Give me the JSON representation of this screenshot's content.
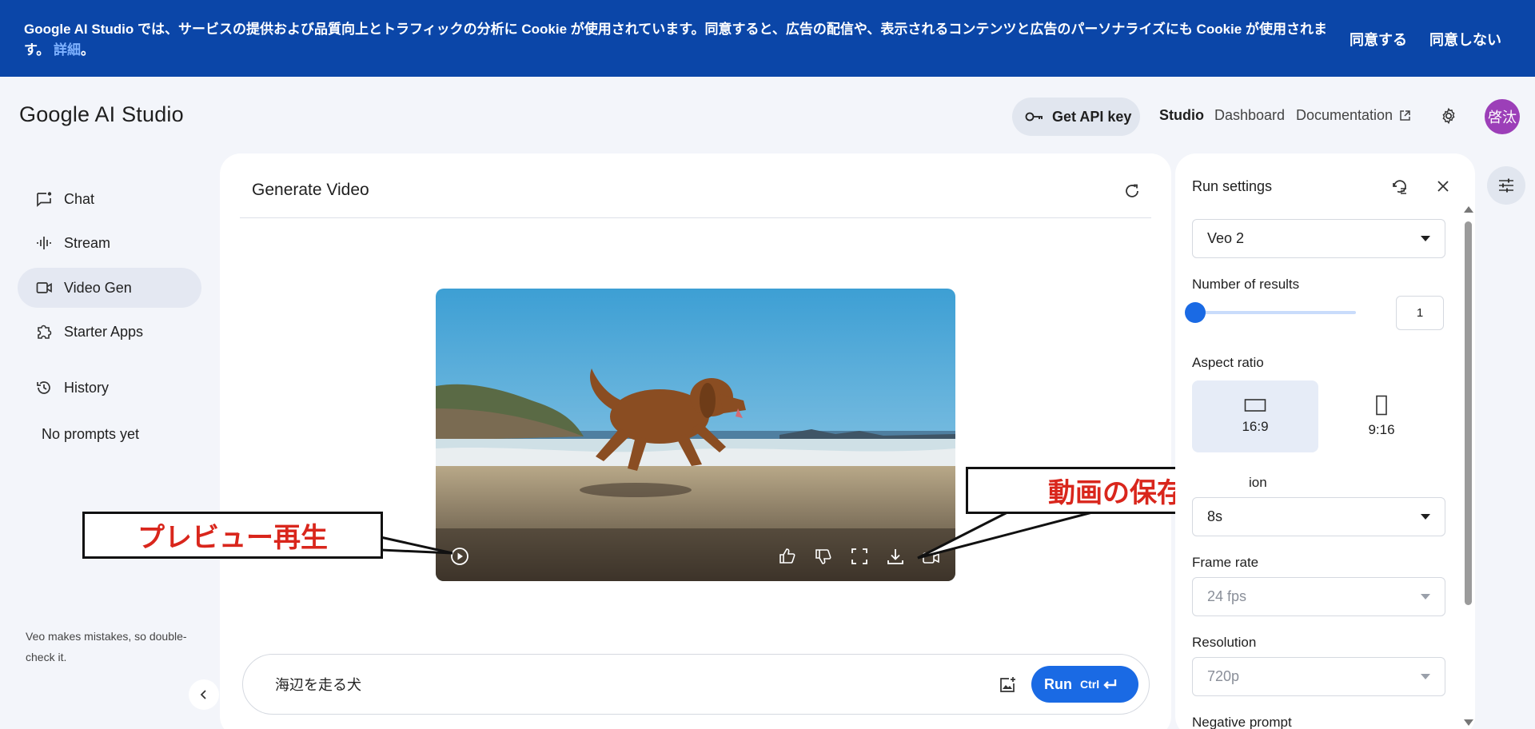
{
  "cookie_banner": {
    "text": "Google AI Studio では、サービスの提供および品質向上とトラフィックの分析に Cookie が使用されています。同意すると、広告の配信や、表示されるコンテンツと広告のパーソナライズにも Cookie が使用されます。",
    "more_link": "詳細",
    "end_punct": "。",
    "agree": "同意する",
    "disagree": "同意しない"
  },
  "header": {
    "logo": "Google AI Studio",
    "api_key_button": "Get API key",
    "nav": {
      "studio": "Studio",
      "dashboard": "Dashboard",
      "documentation": "Documentation"
    },
    "avatar_text": "啓汰"
  },
  "sidebar": {
    "items": [
      {
        "label": "Chat",
        "icon": "chat-icon"
      },
      {
        "label": "Stream",
        "icon": "stream-icon"
      },
      {
        "label": "Video Gen",
        "icon": "video-icon"
      },
      {
        "label": "Starter Apps",
        "icon": "puzzle-icon"
      },
      {
        "label": "History",
        "icon": "history-icon"
      }
    ],
    "active": "Video Gen",
    "no_prompts": "No prompts yet",
    "disclaimer": "Veo makes mistakes, so double-check it."
  },
  "main": {
    "title": "Generate Video",
    "prompt_value": "海辺を走る犬",
    "run_label": "Run",
    "run_shortcut": "Ctrl"
  },
  "annotations": {
    "preview": "プレビュー再生",
    "save": "動画の保存"
  },
  "run_settings": {
    "title": "Run settings",
    "model": "Veo 2",
    "number_of_results_label": "Number of results",
    "number_of_results_value": "1",
    "aspect_ratio_label": "Aspect ratio",
    "aspect_ratios": [
      "16:9",
      "9:16"
    ],
    "selected_aspect_ratio": "16:9",
    "duration_label_visible": "ion",
    "duration_value": "8s",
    "frame_rate_label": "Frame rate",
    "frame_rate_value": "24 fps",
    "resolution_label": "Resolution",
    "resolution_value": "720p",
    "negative_prompt_label": "Negative prompt"
  },
  "colors": {
    "banner": "#0b46a8",
    "accent": "#1a6ae4",
    "avatar": "#9c3fb8",
    "annotation_text": "#d9261c"
  }
}
